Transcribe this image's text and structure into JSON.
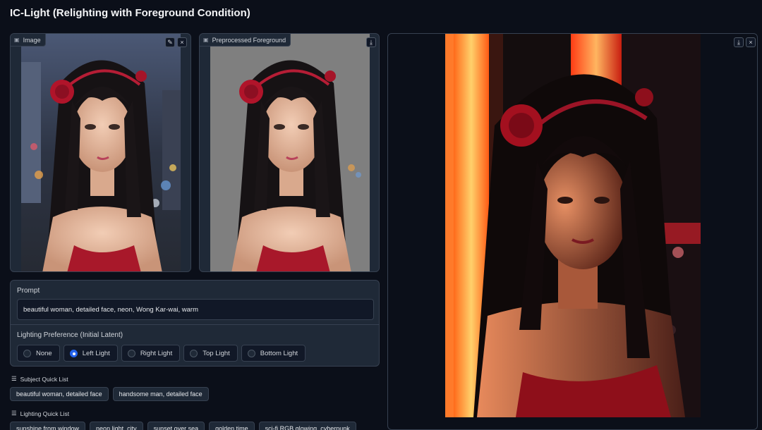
{
  "app": {
    "title": "IC-Light (Relighting with Foreground Condition)"
  },
  "image_panel": {
    "label": "Image",
    "icon": "image-icon",
    "buttons": [
      "pencil-icon",
      "close-icon"
    ]
  },
  "preprocessed_panel": {
    "label": "Preprocessed Foreground",
    "icon": "image-icon",
    "buttons": [
      "download-icon"
    ]
  },
  "result_panel": {
    "buttons": [
      "download-icon",
      "close-icon"
    ]
  },
  "prompt": {
    "label": "Prompt",
    "value": "beautiful woman, detailed face, neon, Wong Kar-wai, warm"
  },
  "lighting": {
    "label": "Lighting Preference (Initial Latent)",
    "options": [
      "None",
      "Left Light",
      "Right Light",
      "Top Light",
      "Bottom Light"
    ],
    "selected": "Left Light"
  },
  "subject_quick_list": {
    "title": "Subject Quick List",
    "items": [
      "beautiful woman, detailed face",
      "handsome man, detailed face"
    ]
  },
  "lighting_quick_list": {
    "title": "Lighting Quick List",
    "items": [
      "sunshine from window",
      "neon light, city",
      "sunset over sea",
      "golden time",
      "sci-fi RGB glowing, cyberpunk"
    ]
  },
  "colors": {
    "accent": "#2563eb",
    "background": "#0b0f19",
    "panel": "#1f2937",
    "border": "#374151"
  }
}
